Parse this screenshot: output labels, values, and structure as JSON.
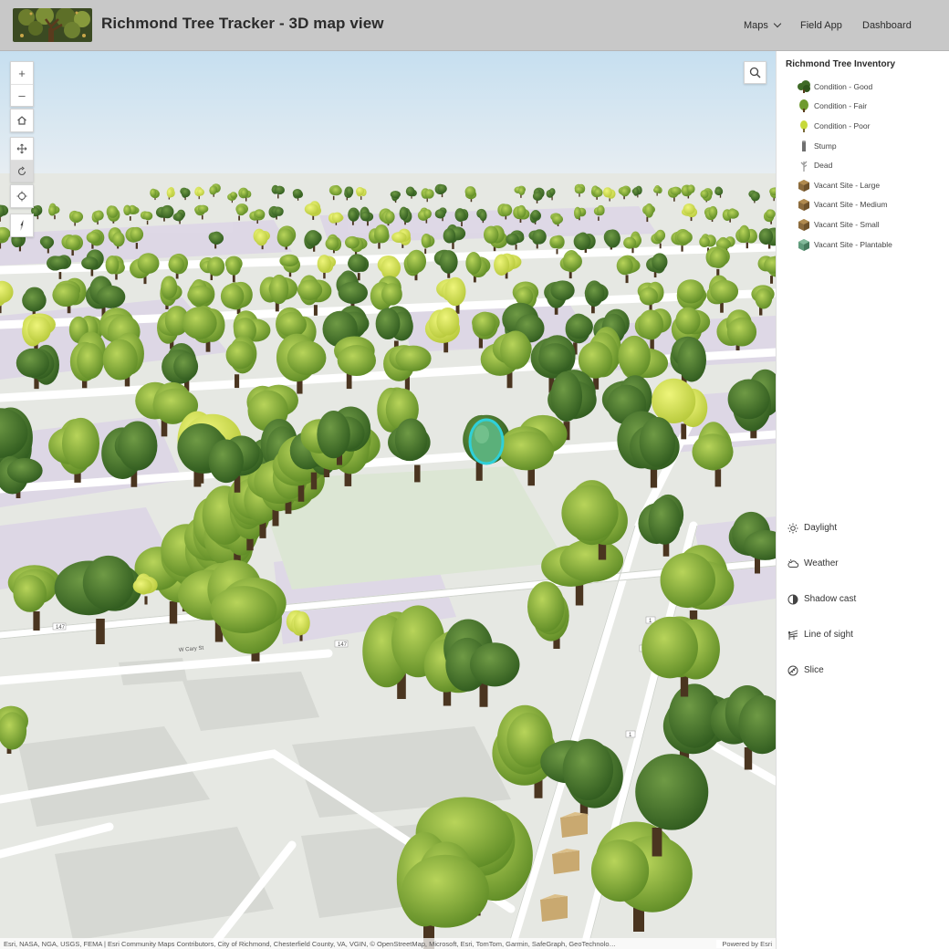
{
  "header": {
    "title": "Richmond Tree Tracker - 3D map view",
    "nav": {
      "maps": "Maps",
      "field_app": "Field App",
      "dashboard": "Dashboard"
    },
    "bg_color": "#c8c8c8"
  },
  "map_controls": {
    "zoom_in": "+",
    "zoom_out": "–"
  },
  "legend": {
    "title": "Richmond Tree Inventory",
    "items": [
      {
        "label": "Condition - Good",
        "icon": "tree-good-icon",
        "color": "#3f6b27"
      },
      {
        "label": "Condition - Fair",
        "icon": "tree-fair-icon",
        "color": "#6e9a2e"
      },
      {
        "label": "Condition - Poor",
        "icon": "tree-poor-icon",
        "color": "#c7d93a"
      },
      {
        "label": "Stump",
        "icon": "stump-icon",
        "color": "#6f6f6f"
      },
      {
        "label": "Dead",
        "icon": "dead-tree-icon",
        "color": "#9a9a9a"
      },
      {
        "label": "Vacant Site - Large",
        "icon": "box-large-icon",
        "color": "#8a6a3c"
      },
      {
        "label": "Vacant Site - Medium",
        "icon": "box-medium-icon",
        "color": "#8a6a3c"
      },
      {
        "label": "Vacant Site - Small",
        "icon": "box-small-icon",
        "color": "#8a6a3c"
      },
      {
        "label": "Vacant Site - Plantable",
        "icon": "box-plantable-icon",
        "color": "#5f9a7a"
      }
    ]
  },
  "tools": [
    {
      "label": "Daylight",
      "icon": "sun-icon"
    },
    {
      "label": "Weather",
      "icon": "cloud-icon"
    },
    {
      "label": "Shadow cast",
      "icon": "shadow-icon"
    },
    {
      "label": "Line of sight",
      "icon": "line-of-sight-icon"
    },
    {
      "label": "Slice",
      "icon": "slice-icon"
    }
  ],
  "map": {
    "road_labels": [
      "147",
      "W Cary St",
      "147",
      "147",
      "1",
      "1"
    ],
    "selection_color": "#2fd0d8"
  },
  "attribution": {
    "credits": "Esri, NASA, NGA, USGS, FEMA | Esri Community Maps Contributors, City of Richmond, Chesterfield County, VA, VGIN, © OpenStreetMap, Microsoft, Esri, TomTom, Garmin, SafeGraph, GeoTechnolo…",
    "powered": "Powered by Esri"
  }
}
